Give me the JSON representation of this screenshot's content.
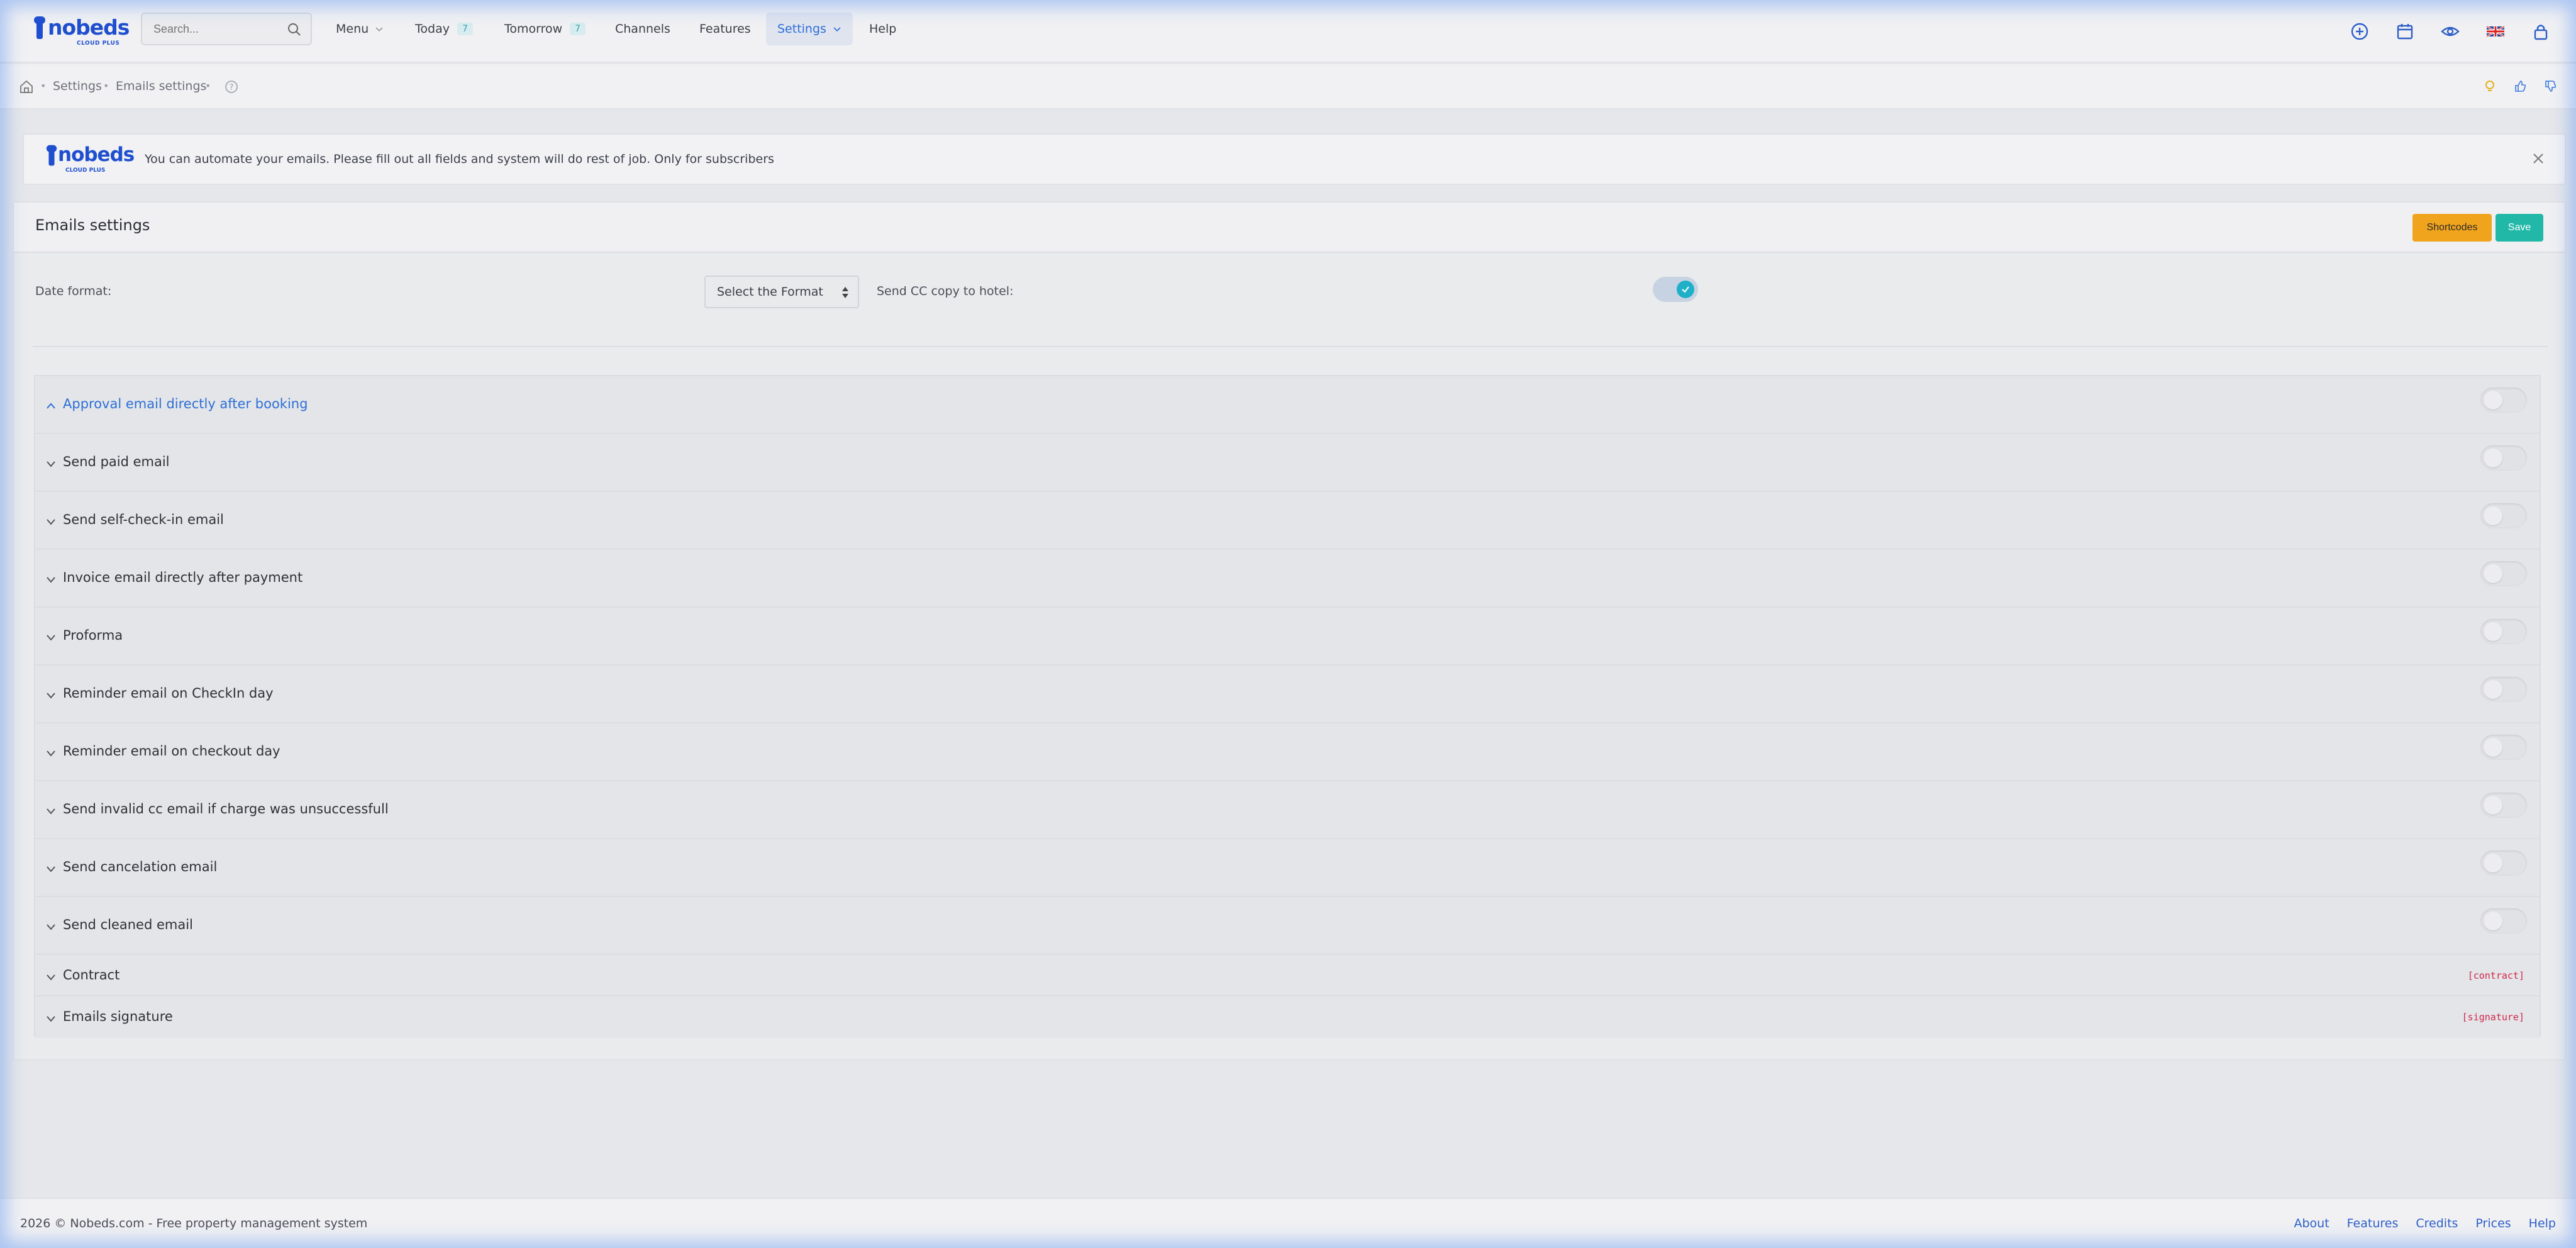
{
  "brand": {
    "name": "nobeds",
    "tagline": "CLOUD PLUS",
    "primary": "#1f4fcf"
  },
  "search": {
    "placeholder": "Search..."
  },
  "nav": {
    "menu": "Menu",
    "today": "Today",
    "today_count": "7",
    "tomorrow": "Tomorrow",
    "tomorrow_count": "7",
    "channels": "Channels",
    "features": "Features",
    "settings": "Settings",
    "help": "Help"
  },
  "breadcrumb": {
    "settings": "Settings",
    "current": "Emails settings"
  },
  "notice": {
    "text": "You can automate your emails. Please fill out all fields and system will do rest of job. Only for subscribers"
  },
  "panel": {
    "title": "Emails settings",
    "shortcodes_label": "Shortcodes",
    "save_label": "Save",
    "date_format_label": "Date format:",
    "date_format_value": "Select the Format",
    "cc_label": "Send CC copy to hotel:"
  },
  "sections": [
    {
      "label": "Approval email directly after booking",
      "active": true
    },
    {
      "label": "Send paid email"
    },
    {
      "label": "Send self-check-in email"
    },
    {
      "label": "Invoice email directly after payment"
    },
    {
      "label": "Proforma"
    },
    {
      "label": "Reminder email on CheckIn day"
    },
    {
      "label": "Reminder email on checkout day"
    },
    {
      "label": "Send invalid cc email if charge was unsuccessfull"
    },
    {
      "label": "Send cancelation email"
    },
    {
      "label": "Send cleaned email"
    }
  ],
  "extra_sections": [
    {
      "label": "Contract",
      "code": "[contract]"
    },
    {
      "label": "Emails signature",
      "code": "[signature]"
    }
  ],
  "footer": {
    "copyright": "2026  © Nobeds.com - Free property management system",
    "links": [
      "About",
      "Features",
      "Credits",
      "Prices",
      "Help"
    ]
  },
  "colors": {
    "accent_teal": "#22b8a8",
    "accent_orange": "#f0a41e",
    "link_blue": "#2d6fd6",
    "code_red": "#d0284b"
  }
}
